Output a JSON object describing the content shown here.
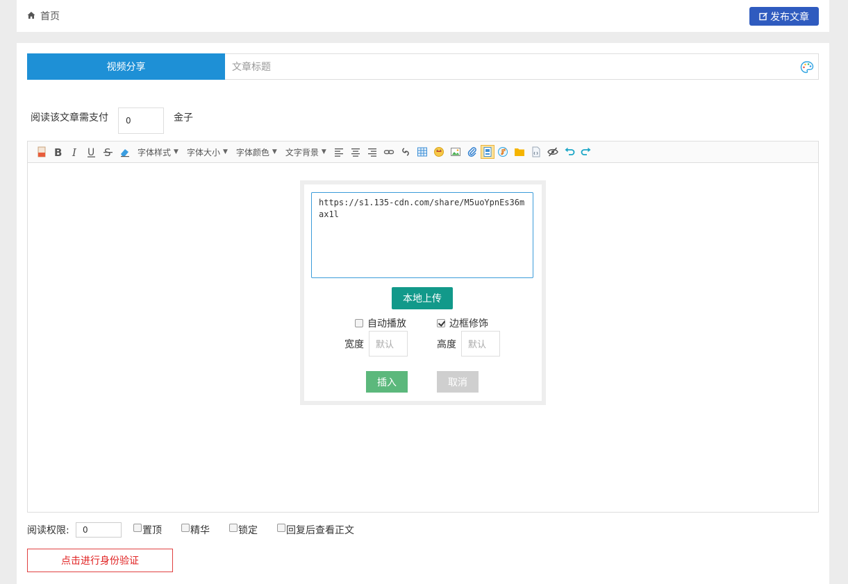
{
  "header": {
    "home_label": "首页",
    "publish_label": "发布文章"
  },
  "form": {
    "category_tab": "视频分享",
    "title_placeholder": "文章标题",
    "pay_label": "阅读该文章需支付",
    "pay_value": "0",
    "pay_unit": "金子"
  },
  "toolbar": {
    "dropdowns": [
      "字体样式",
      "字体大小",
      "字体颜色",
      "文字背景"
    ]
  },
  "video_dialog": {
    "url_value": "https://s1.135-cdn.com/share/M5uoYpnEs36max1l",
    "upload_label": "本地上传",
    "autoplay_label": "自动播放",
    "autoplay_checked": false,
    "border_label": "边框修饰",
    "border_checked": true,
    "width_label": "宽度",
    "width_placeholder": "默认",
    "height_label": "高度",
    "height_placeholder": "默认",
    "insert_label": "插入",
    "cancel_label": "取消"
  },
  "footer": {
    "perm_label": "阅读权限:",
    "perm_value": "0",
    "options": [
      "置顶",
      "精华",
      "锁定",
      "回复后查看正文"
    ],
    "verify_label": "点击进行身份验证"
  },
  "colors": {
    "publish_bg": "#2f5bbf",
    "tab_bg": "#1e90d6",
    "upload_bg": "#12998a",
    "insert_bg": "#5cb87c",
    "verify_border": "#e04040"
  }
}
